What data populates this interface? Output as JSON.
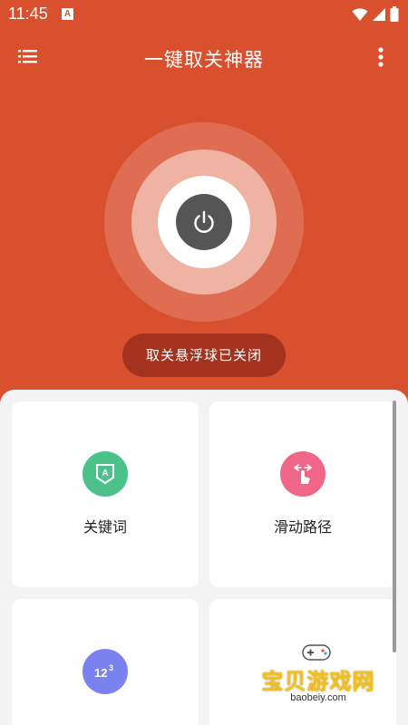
{
  "status_bar": {
    "time": "11:45",
    "notification_icon": "a-letter-icon",
    "right_icons": [
      "wifi-icon",
      "signal-icon",
      "battery-icon"
    ]
  },
  "app_bar": {
    "title": "一键取关神器",
    "left_icon": "list-menu-icon",
    "right_icon": "more-vertical-icon"
  },
  "main": {
    "power_icon": "power-icon",
    "status_text": "取关悬浮球已关闭"
  },
  "cards": [
    {
      "label": "关键词",
      "icon": "keyword-icon",
      "icon_color": "#4cc18a"
    },
    {
      "label": "滑动路径",
      "icon": "swipe-gesture-icon",
      "icon_color": "#ef6688"
    },
    {
      "label": "",
      "icon": "numbers-123-icon",
      "icon_color": "#7a82f0"
    },
    {
      "label": "",
      "icon": "",
      "icon_color": ""
    }
  ],
  "watermark": {
    "text": "宝贝游戏网",
    "url": "baobeiy.com"
  },
  "colors": {
    "primary": "#d9502f",
    "pill": "#a3331e",
    "power_button": "#555555",
    "panel_background": "#f3f3f3"
  }
}
